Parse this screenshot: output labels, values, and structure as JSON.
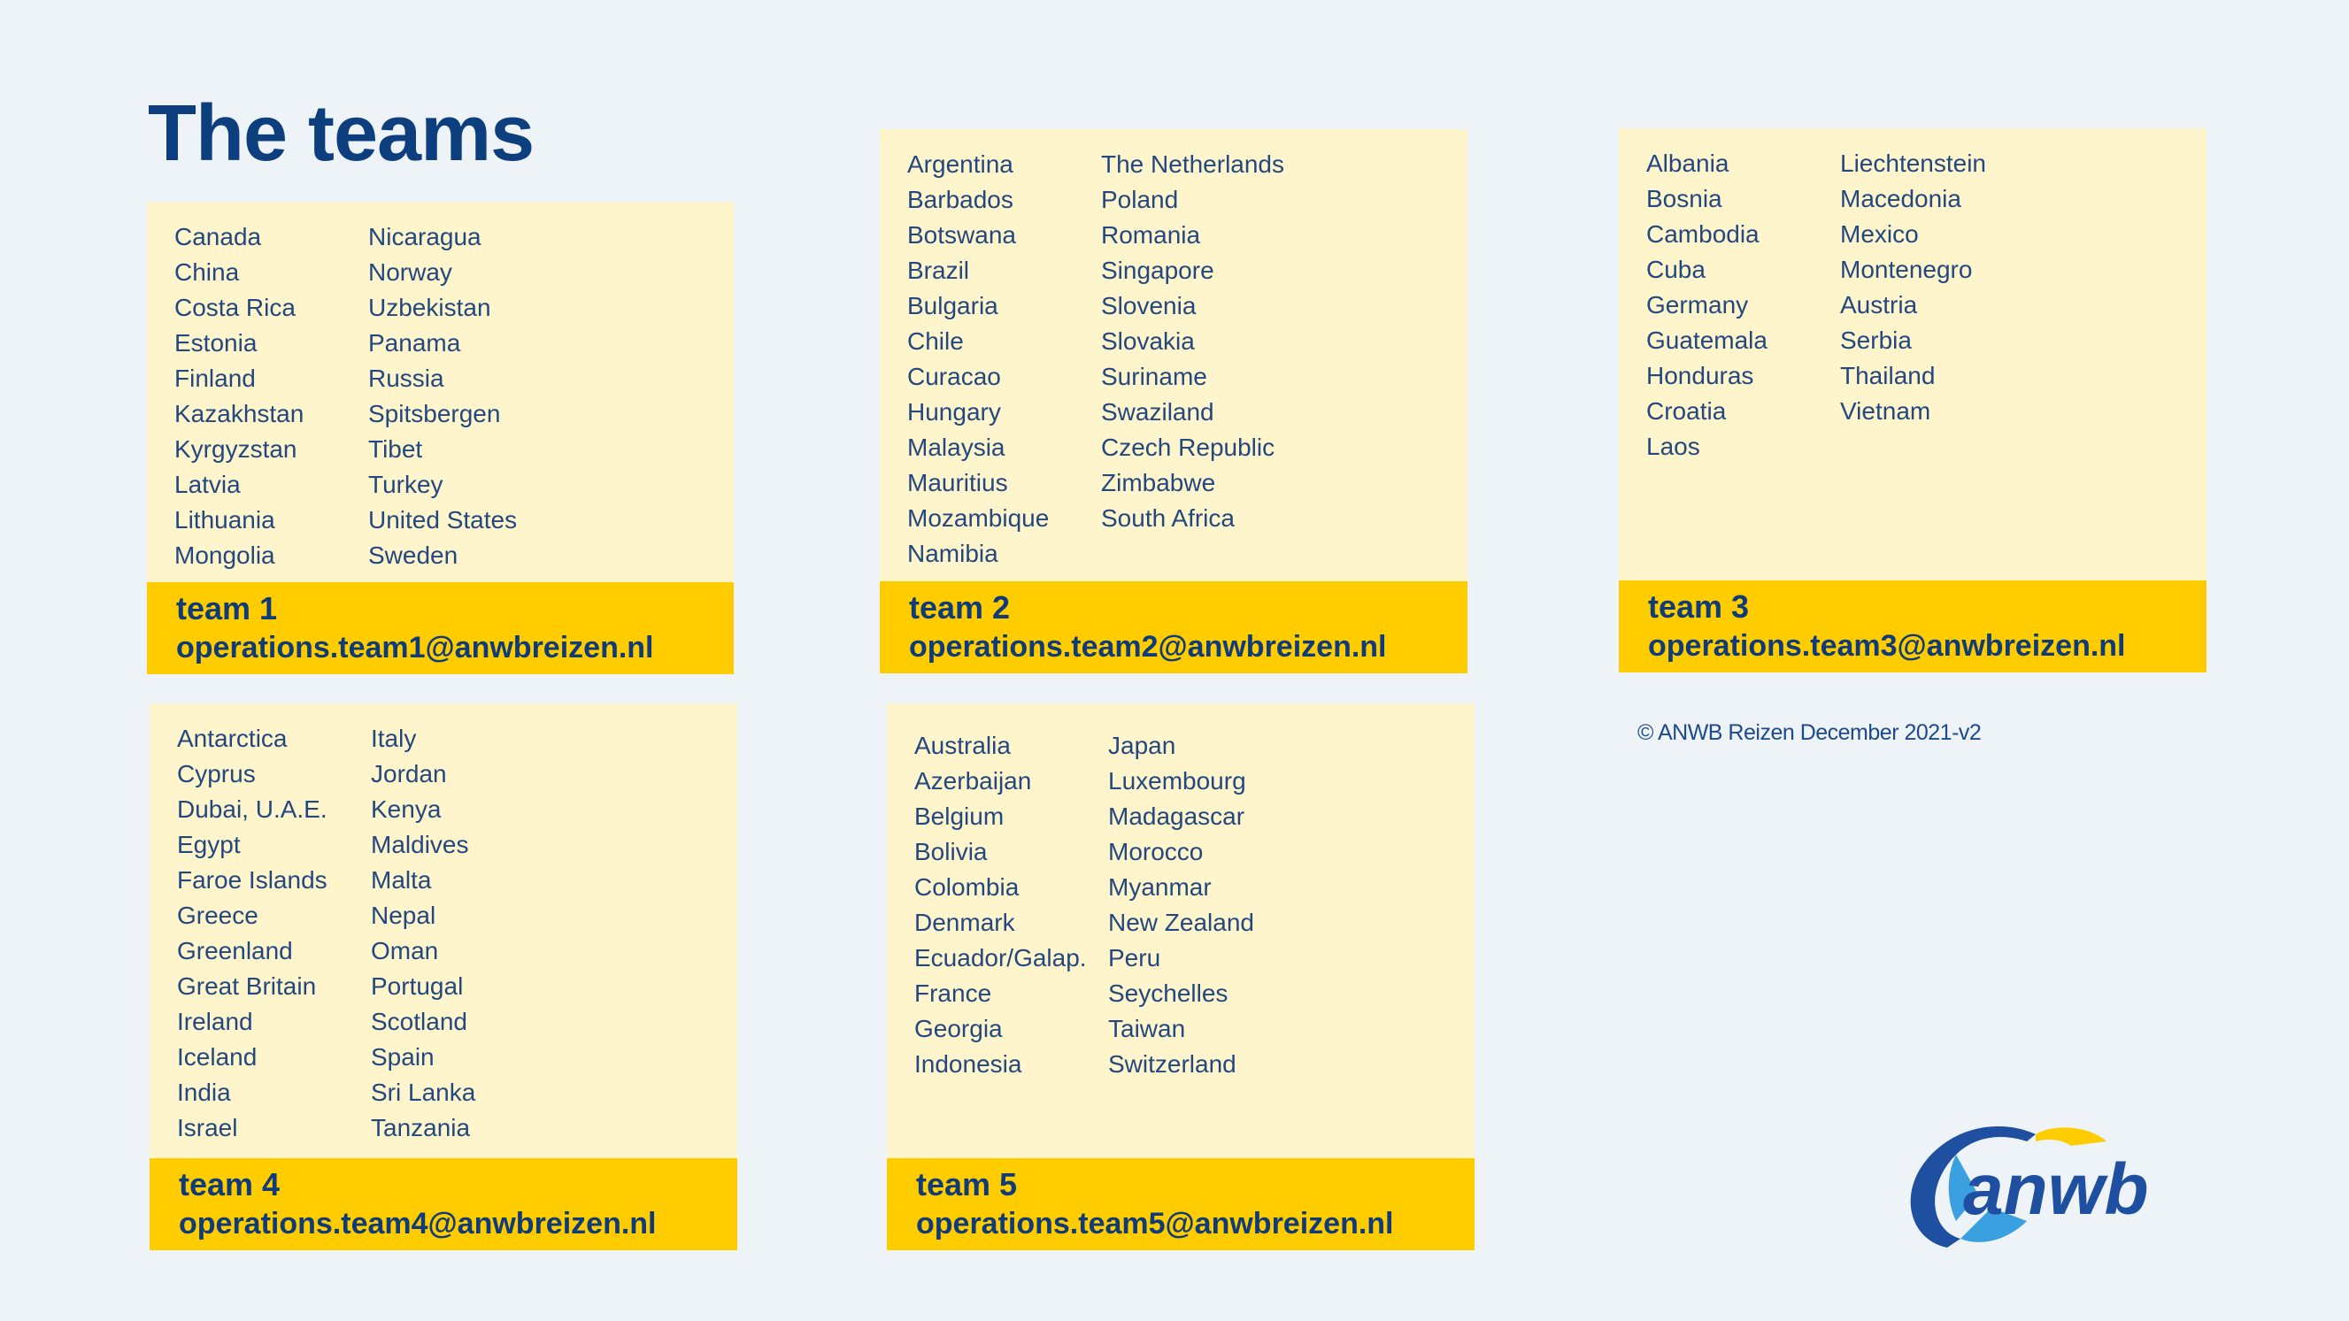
{
  "title": "The teams",
  "teams": [
    {
      "name": "team 1",
      "email": "operations.team1@anwbreizen.nl",
      "col1": [
        "Canada",
        "China",
        "Costa Rica",
        "Estonia",
        "Finland",
        "Kazakhstan",
        "Kyrgyzstan",
        "Latvia",
        "Lithuania",
        "Mongolia"
      ],
      "col2": [
        "Nicaragua",
        "Norway",
        "Uzbekistan",
        "Panama",
        "Russia",
        "Spitsbergen",
        "Tibet",
        "Turkey",
        "United States",
        "Sweden"
      ]
    },
    {
      "name": "team 2",
      "email": "operations.team2@anwbreizen.nl",
      "col1": [
        "Argentina",
        "Barbados",
        "Botswana",
        "Brazil",
        "Bulgaria",
        "Chile",
        "Curacao",
        "Hungary",
        "Malaysia",
        "Mauritius",
        "Mozambique",
        "Namibia"
      ],
      "col2": [
        "The Netherlands",
        "Poland",
        "Romania",
        "Singapore",
        "Slovenia",
        "Slovakia",
        "Suriname",
        "Swaziland",
        "Czech Republic",
        "Zimbabwe",
        "South Africa"
      ]
    },
    {
      "name": "team 3",
      "email": "operations.team3@anwbreizen.nl",
      "col1": [
        "Albania",
        "Bosnia",
        "Cambodia",
        "Cuba",
        "Germany",
        "Guatemala",
        "Honduras",
        "Croatia",
        "Laos"
      ],
      "col2": [
        "Liechtenstein",
        "Macedonia",
        "Mexico",
        "Montenegro",
        "Austria",
        "Serbia",
        "Thailand",
        "Vietnam"
      ]
    },
    {
      "name": "team 4",
      "email": "operations.team4@anwbreizen.nl",
      "col1": [
        "Antarctica",
        "Cyprus",
        "Dubai, U.A.E.",
        "Egypt",
        "Faroe Islands",
        "Greece",
        "Greenland",
        "Great Britain",
        "Ireland",
        "Iceland",
        "India",
        "Israel"
      ],
      "col2": [
        "Italy",
        "Jordan",
        "Kenya",
        "Maldives",
        "Malta",
        "Nepal",
        "Oman",
        "Portugal",
        "Scotland",
        "Spain",
        "Sri Lanka",
        "Tanzania"
      ]
    },
    {
      "name": "team 5",
      "email": "operations.team5@anwbreizen.nl",
      "col1": [
        "Australia",
        "Azerbaijan",
        "Belgium",
        "Bolivia",
        "Colombia",
        "Denmark",
        "Ecuador/Galap.",
        "France",
        "Georgia",
        "Indonesia"
      ],
      "col2": [
        "Japan",
        "Luxembourg",
        "Madagascar",
        "Morocco",
        "Myanmar",
        "New Zealand",
        "Peru",
        "Seychelles",
        "Taiwan",
        "Switzerland"
      ]
    }
  ],
  "copyright": "© ANWB Reizen December 2021-v2",
  "logo": {
    "text": "anwb",
    "icon": "anwb-logo-icon",
    "colors": {
      "blue": "#1f4fa0",
      "yellow": "#ffcc00",
      "light_blue": "#3aa0e0"
    }
  },
  "colors": {
    "background": "#eef3f8",
    "card": "#fff5cc",
    "band": "#ffcc00",
    "title": "#0d3f7e",
    "text": "#23487f"
  }
}
